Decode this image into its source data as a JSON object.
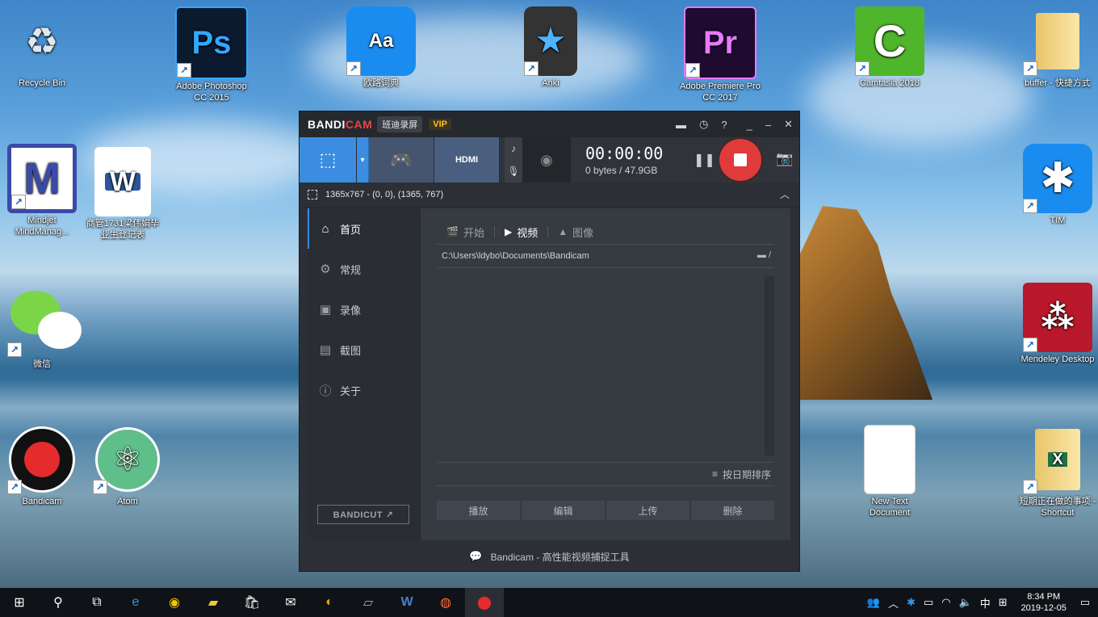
{
  "desktop_icons": [
    {
      "label": "Recycle Bin",
      "icon": "recycle-bin-icon"
    },
    {
      "label": "Adobe Photoshop CC 2015",
      "icon": "photoshop-icon"
    },
    {
      "label": "欧路词典",
      "icon": "eudic-icon"
    },
    {
      "label": "Anki",
      "icon": "anki-icon"
    },
    {
      "label": "Adobe Premiere Pro CC 2017",
      "icon": "premiere-icon"
    },
    {
      "label": "Camtasia 2018",
      "icon": "camtasia-icon"
    },
    {
      "label": "buffer - 快捷方式",
      "icon": "folder-icon"
    },
    {
      "label": "Mindjet MindManag...",
      "icon": "mindmanager-icon"
    },
    {
      "label": "商管1731梁伟娟毕业生登记表",
      "icon": "word-doc-icon"
    },
    {
      "label": "TIM",
      "icon": "tim-icon"
    },
    {
      "label": "微信",
      "icon": "wechat-icon"
    },
    {
      "label": "Mendeley Desktop",
      "icon": "mendeley-icon"
    },
    {
      "label": "Bandicam",
      "icon": "bandicam-icon"
    },
    {
      "label": "Atom",
      "icon": "atom-icon"
    },
    {
      "label": "New Text Document",
      "icon": "text-doc-icon"
    },
    {
      "label": "短期正在做的事项 - Shortcut",
      "icon": "excel-icon"
    }
  ],
  "window": {
    "logo_main": "BANDI",
    "logo_accent": "CAM",
    "brand_cn": "班迪录屏",
    "vip": "VIP",
    "title_icons": [
      "folder-icon",
      "clock-icon",
      "help-icon",
      "minimize-icon",
      "maximize-icon",
      "close-icon"
    ],
    "timer": "00:00:00",
    "bytes": "0 bytes / 47.9GB",
    "hdmi_label": "HDMI",
    "area_info": "1365x767 - (0, 0), (1365, 767)",
    "sidebar": [
      {
        "label": "首页",
        "icon": "home-icon"
      },
      {
        "label": "常规",
        "icon": "gear-icon"
      },
      {
        "label": "录像",
        "icon": "video-settings-icon"
      },
      {
        "label": "截图",
        "icon": "screenshot-settings-icon"
      },
      {
        "label": "关于",
        "icon": "info-icon"
      }
    ],
    "bandicut_label": "BANDICUT ↗",
    "tabs": [
      {
        "label": "开始",
        "icon": "clapper-icon"
      },
      {
        "label": "视频",
        "icon": "play-icon"
      },
      {
        "label": "图像",
        "icon": "image-icon"
      }
    ],
    "path": "C:\\Users\\ldybo\\Documents\\Bandicam",
    "path_folder": "/",
    "sort_label": "按日期排序",
    "actions": [
      "播放",
      "编辑",
      "上传",
      "删除"
    ],
    "footer": "Bandicam - 高性能视频捕捉工具"
  },
  "taskbar": {
    "apps": [
      "windows-start-icon",
      "search-icon",
      "task-view-icon",
      "edge-icon",
      "chrome-icon",
      "file-explorer-icon",
      "store-icon",
      "mail-icon",
      "speaker-app-icon",
      "notes-icon",
      "word-icon",
      "firefox-icon",
      "bandicam-record-icon"
    ],
    "ime": "中",
    "time": "8:34 PM",
    "date": "2019-12-05"
  }
}
